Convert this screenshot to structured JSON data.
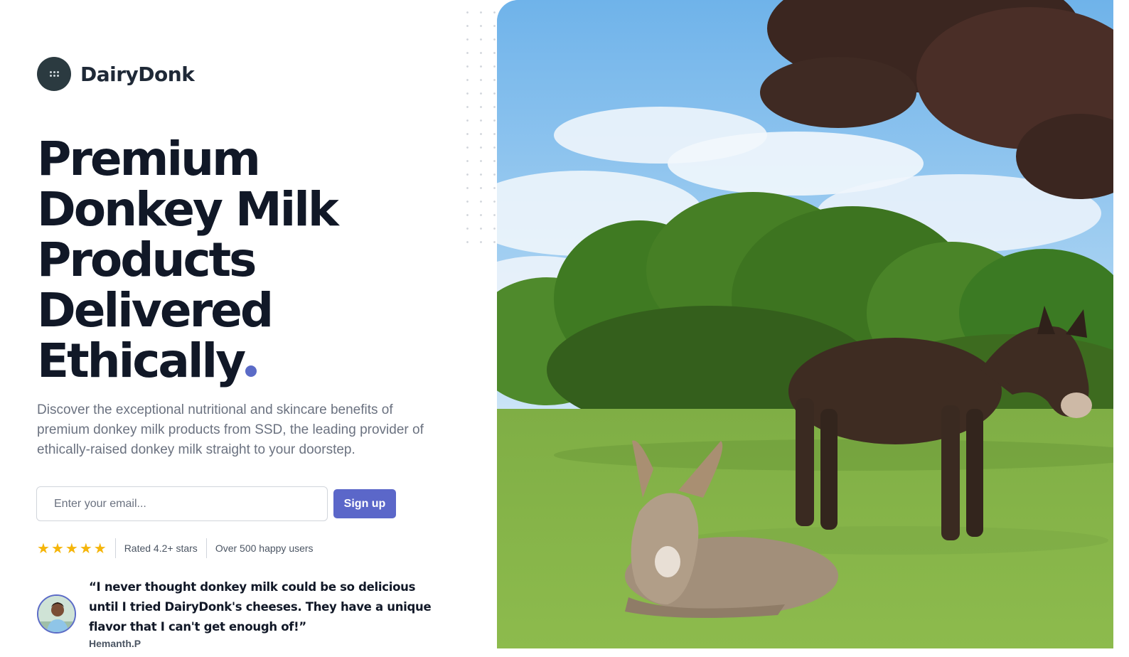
{
  "brand": {
    "name": "DairyDonk",
    "logo_icon": "grid-dots-icon"
  },
  "hero": {
    "headline_lines": [
      "Premium",
      "Donkey Milk",
      "Products",
      "Delivered",
      "Ethically"
    ],
    "description": "Discover the exceptional nutritional and skincare benefits of premium donkey milk products from SSD, the leading provider of ethically-raised donkey milk straight to your doorstep.",
    "accent_color": "#5b6bc7"
  },
  "signup": {
    "email_placeholder": "Enter your email...",
    "button_label": "Sign up",
    "button_color": "#5b67c9"
  },
  "rating": {
    "stars": 5,
    "star_icon": "star-icon",
    "rated_text": "Rated 4.2+ stars",
    "users_text": "Over 500 happy users"
  },
  "testimonial": {
    "quote": "“I never thought donkey milk could be so delicious until I tried DairyDonk's cheeses. They have a unique flavor that I can't get enough of!”",
    "author": "Hemanth.P"
  }
}
